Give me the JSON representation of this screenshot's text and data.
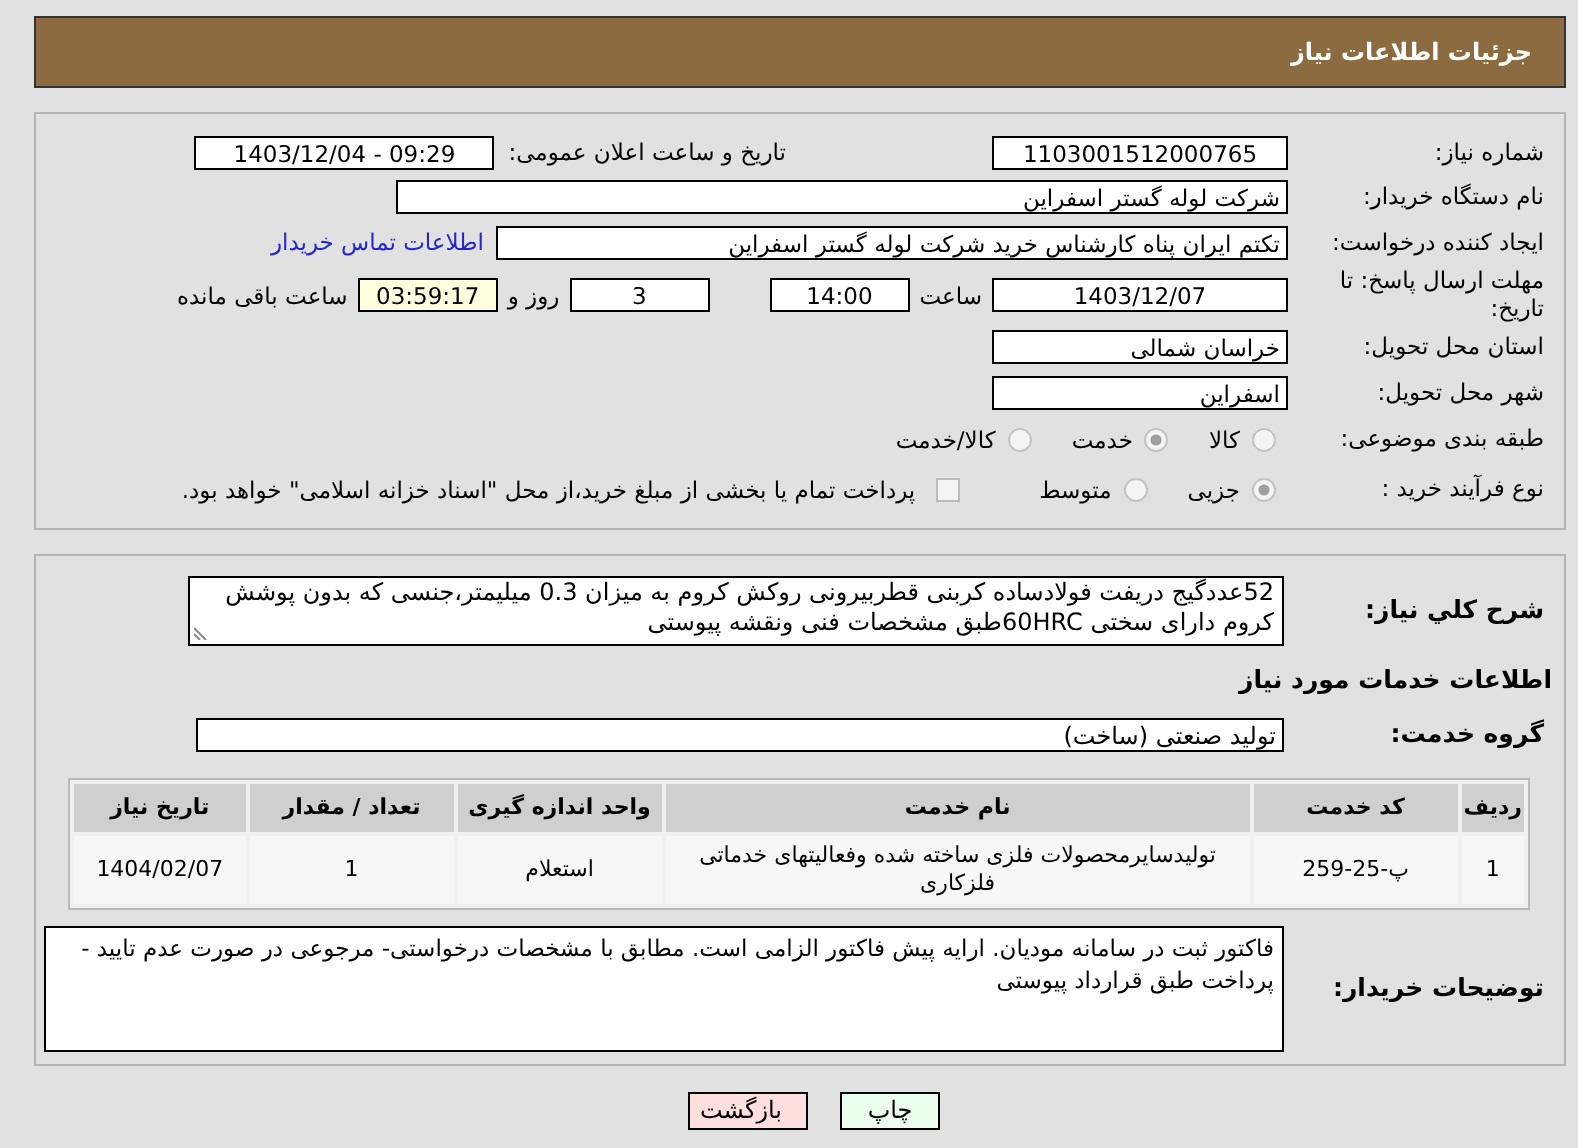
{
  "header": {
    "title": "جزئیات اطلاعات نیاز"
  },
  "need_number": {
    "label": "شماره نیاز:",
    "value": "1103001512000765"
  },
  "announce_date": {
    "label": "تاریخ و ساعت اعلان عمومی:",
    "value": "1403/12/04 - 09:29"
  },
  "buyer_org": {
    "label": "نام دستگاه خریدار:",
    "value": "شرکت لوله گستر اسفراین"
  },
  "requester": {
    "label": "ایجاد کننده درخواست:",
    "value": "تکتم ایران پناه کارشناس خرید شرکت لوله گستر اسفراین",
    "link": "اطلاعات تماس خریدار"
  },
  "deadline": {
    "label": "مهلت ارسال پاسخ: تا تاریخ:",
    "date": "1403/12/07",
    "time_label": "ساعت",
    "time": "14:00",
    "days": "3",
    "days_label": "روز و",
    "remaining": "03:59:17",
    "remaining_label": "ساعت باقی مانده"
  },
  "province": {
    "label": "استان محل تحویل:",
    "value": "خراسان شمالی"
  },
  "city": {
    "label": "شهر محل تحویل:",
    "value": "اسفراین"
  },
  "subject_category": {
    "label": "طبقه بندی موضوعی:",
    "options": [
      {
        "label": "کالا",
        "selected": false
      },
      {
        "label": "خدمت",
        "selected": true
      },
      {
        "label": "کالا/خدمت",
        "selected": false
      }
    ]
  },
  "purchase_process": {
    "label": "نوع فرآیند خرید :",
    "options": [
      {
        "label": "جزیی",
        "selected": true
      },
      {
        "label": "متوسط",
        "selected": false
      }
    ],
    "payment": {
      "checked": false,
      "text": "پرداخت تمام یا بخشی از مبلغ خرید،از محل \"اسناد خزانه اسلامی\" خواهد بود."
    }
  },
  "description": {
    "label": "شرح کلي نياز:",
    "value": "52عددگیج دریفت فولادساده کربنی قطربیرونی روکش کروم به میزان 0.3 میلیمتر،جنسی که بدون پوشش کروم دارای سختی 60HRCطبق مشخصات فنی  ونقشه پیوستی"
  },
  "services_heading": "اطلاعات خدمات مورد نیاز",
  "service_group": {
    "label": "گروه خدمت:",
    "value": "تولید صنعتی (ساخت)"
  },
  "table": {
    "columns": [
      "ردیف",
      "کد خدمت",
      "نام خدمت",
      "واحد اندازه گیری",
      "تعداد / مقدار",
      "تاریخ نیاز"
    ],
    "rows": [
      [
        "1",
        "پ-25-259",
        "تولیدسایرمحصولات فلزی ساخته شده وفعالیتهای خدماتی فلزکاری",
        "استعلام",
        "1",
        "1404/02/07"
      ]
    ]
  },
  "buyer_notes": {
    "label": "توضیحات خریدار:",
    "value": "فاکتور ثبت در سامانه مودیان. ارایه پیش فاکتور الزامی است. مطابق با مشخصات درخواستی- مرجوعی در صورت عدم تایید - پرداخت طبق قرارداد پیوستی"
  },
  "buttons": [
    {
      "label": "چاپ",
      "kind": "print"
    },
    {
      "label": "بازگشت",
      "kind": "back"
    }
  ]
}
